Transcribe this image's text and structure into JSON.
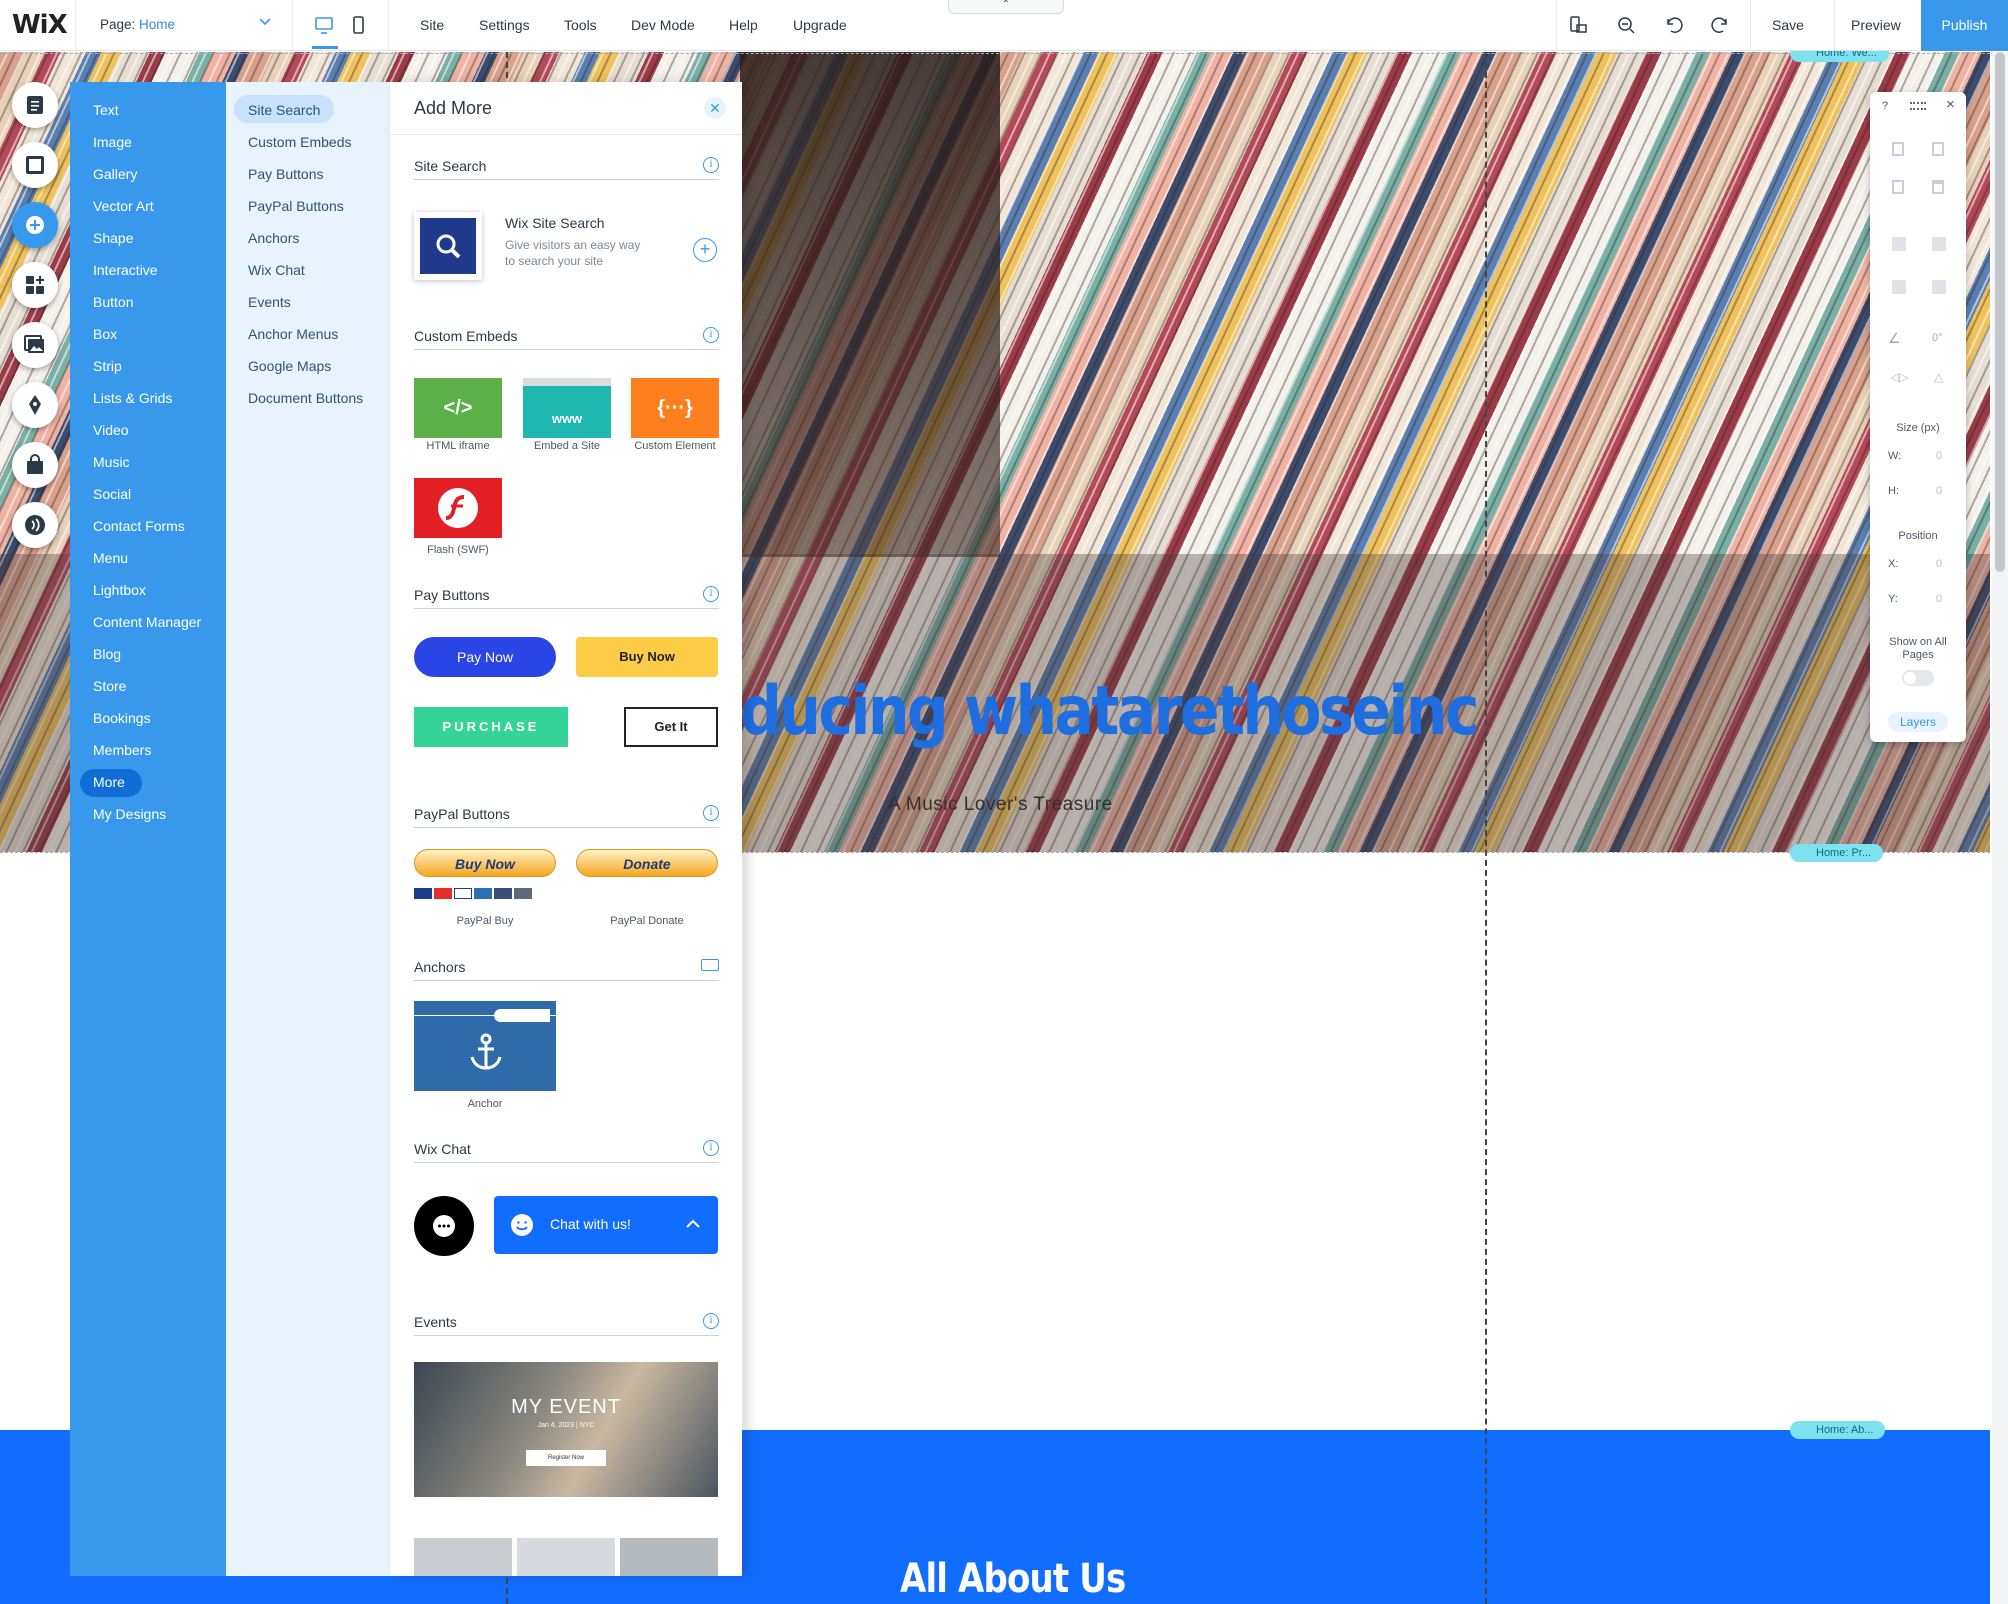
{
  "topbar": {
    "logo": "WiX",
    "page_label": "Page:",
    "page_value": "Home",
    "menu": [
      "Site",
      "Settings",
      "Tools",
      "Dev Mode",
      "Help",
      "Upgrade"
    ],
    "save": "Save",
    "preview": "Preview",
    "publish": "Publish",
    "accent": "#3899ec"
  },
  "hero": {
    "title": "ducing whatarethoseinc",
    "subtitle": "A Music Lover's Treasure",
    "title_color": "#1f6ee0"
  },
  "footer_section": {
    "title": "All About Us",
    "bg": "#116dff"
  },
  "anchors_on_canvas": [
    "Home: We...",
    "Home: Pr...",
    "Home: Ab..."
  ],
  "rail_icons": [
    "pages-icon",
    "background-icon",
    "add-icon",
    "apps-icon",
    "media-icon",
    "design-icon",
    "store-icon",
    "chat-icon"
  ],
  "categories": [
    "Text",
    "Image",
    "Gallery",
    "Vector Art",
    "Shape",
    "Interactive",
    "Button",
    "Box",
    "Strip",
    "Lists & Grids",
    "Video",
    "Music",
    "Social",
    "Contact Forms",
    "Menu",
    "Lightbox",
    "Content Manager",
    "Blog",
    "Store",
    "Bookings",
    "Members",
    "More",
    "My Designs"
  ],
  "subcategories": [
    "Site Search",
    "Custom Embeds",
    "Pay Buttons",
    "PayPal Buttons",
    "Anchors",
    "Wix Chat",
    "Events",
    "Anchor Menus",
    "Google Maps",
    "Document Buttons"
  ],
  "panel": {
    "title": "Add More",
    "site_search": {
      "header": "Site Search",
      "item_title": "Wix Site Search",
      "item_desc_1": "Give visitors an easy way",
      "item_desc_2": "to search your site"
    },
    "custom_embeds": {
      "header": "Custom Embeds",
      "html_glyph": "</>",
      "www_glyph": "www",
      "custom_glyph": "{···}",
      "captions": [
        "HTML iframe",
        "Embed a Site",
        "Custom Element",
        "Flash (SWF)"
      ]
    },
    "pay_buttons": {
      "header": "Pay Buttons",
      "labels": [
        "Pay Now",
        "Buy Now",
        "PURCHASE",
        "Get It"
      ]
    },
    "paypal_buttons": {
      "header": "PayPal Buttons",
      "labels": [
        "Buy Now",
        "Donate"
      ],
      "captions": [
        "PayPal Buy",
        "PayPal Donate"
      ]
    },
    "anchors": {
      "header": "Anchors",
      "caption": "Anchor"
    },
    "wix_chat": {
      "header": "Wix Chat",
      "chat_label": "Chat with us!"
    },
    "events": {
      "header": "Events",
      "event_title": "MY EVENT",
      "event_date": "Jan 4, 2023 | NYC",
      "event_btn": "Register Now"
    }
  },
  "inspector": {
    "help": "?",
    "close": "×",
    "angle": "0°",
    "size_label": "Size (px)",
    "w_label": "W:",
    "w_value": "0",
    "h_label": "H:",
    "h_value": "0",
    "position_label": "Position",
    "x_label": "X:",
    "x_value": "0",
    "y_label": "Y:",
    "y_value": "0",
    "show_all_1": "Show on All",
    "show_all_2": "Pages",
    "layers": "Layers"
  }
}
